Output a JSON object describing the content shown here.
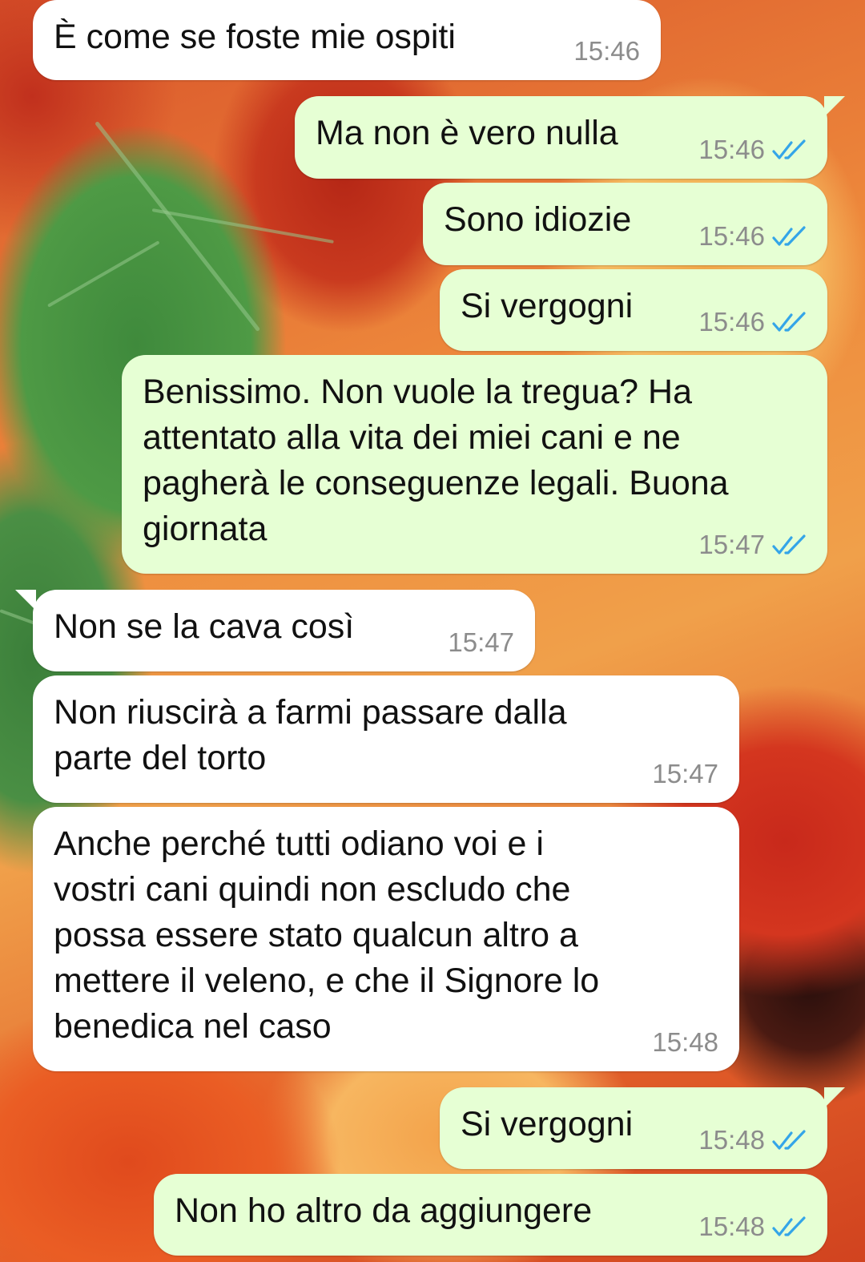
{
  "colors": {
    "incoming_bubble": "#ffffff",
    "outgoing_bubble": "#e6ffd4",
    "timestamp": "#8c8c8c",
    "read_ticks": "#34a5e8"
  },
  "messages": [
    {
      "direction": "incoming",
      "text": "È come se foste mie ospiti",
      "time": "15:46"
    },
    {
      "direction": "outgoing",
      "text": "Ma non è vero nulla",
      "time": "15:46",
      "status_icon": "double-check-read-icon"
    },
    {
      "direction": "outgoing",
      "text": "Sono idiozie",
      "time": "15:46",
      "status_icon": "double-check-read-icon"
    },
    {
      "direction": "outgoing",
      "text": "Si vergogni",
      "time": "15:46",
      "status_icon": "double-check-read-icon"
    },
    {
      "direction": "outgoing",
      "text": "Benissimo. Non vuole la tregua? Ha\nattentato alla vita dei miei cani e ne\npagherà le conseguenze legali. Buona\ngiornata",
      "time": "15:47",
      "status_icon": "double-check-read-icon"
    },
    {
      "direction": "incoming",
      "text": "Non se la cava così",
      "time": "15:47"
    },
    {
      "direction": "incoming",
      "text": "Non riuscirà a farmi passare dalla\nparte del torto",
      "time": "15:47"
    },
    {
      "direction": "incoming",
      "text": "Anche perché tutti odiano voi e i\nvostri cani quindi non escludo che\npossa essere stato qualcun altro a\nmettere il veleno, e che il Signore lo\nbenedica nel caso",
      "time": "15:48"
    },
    {
      "direction": "outgoing",
      "text": "Si vergogni",
      "time": "15:48",
      "status_icon": "double-check-read-icon"
    },
    {
      "direction": "outgoing",
      "text": "Non ho altro da aggiungere",
      "time": "15:48",
      "status_icon": "double-check-read-icon"
    }
  ]
}
